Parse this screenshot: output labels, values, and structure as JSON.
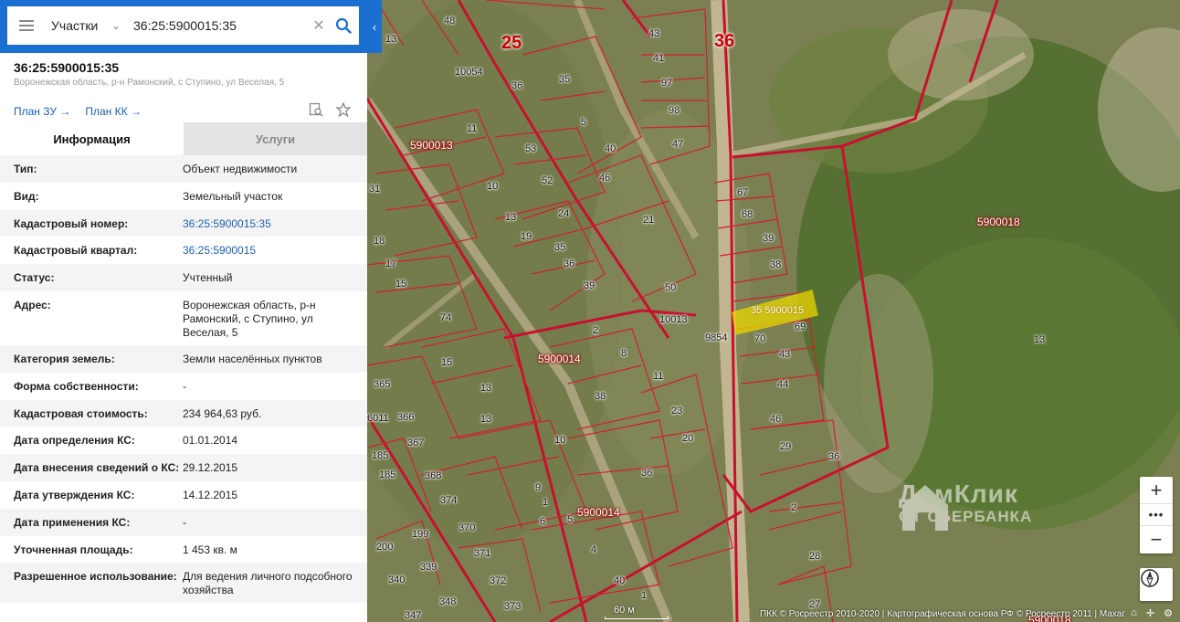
{
  "search": {
    "type_label": "Участки",
    "query": "36:25:5900015:35"
  },
  "object": {
    "title": "36:25:5900015:35",
    "address": "Воронежская область, р-н Рамонский, с Ступино, ул Веселая, 5",
    "plan_zu": "План ЗУ →",
    "plan_kk": "План КК →"
  },
  "tabs": [
    {
      "label": "Информация",
      "active": true
    },
    {
      "label": "Услуги",
      "active": false
    }
  ],
  "info": [
    {
      "key": "Тип:",
      "value": "Объект недвижимости"
    },
    {
      "key": "Вид:",
      "value": "Земельный участок"
    },
    {
      "key": "Кадастровый номер:",
      "value": "36:25:5900015:35",
      "link": true
    },
    {
      "key": "Кадастровый квартал:",
      "value": "36:25:5900015",
      "link": true
    },
    {
      "key": "Статус:",
      "value": "Учтенный"
    },
    {
      "key": "Адрес:",
      "value": "Воронежская область, р-н Рамонский, с Ступино, ул Веселая, 5"
    },
    {
      "key": "Категория земель:",
      "value": "Земли населённых пунктов"
    },
    {
      "key": "Форма собственности:",
      "value": "-"
    },
    {
      "key": "Кадастровая стоимость:",
      "value": "234 964,63 руб."
    },
    {
      "key": "Дата определения КС:",
      "value": "01.01.2014"
    },
    {
      "key": "Дата внесения сведений о КС:",
      "value": "29.12.2015"
    },
    {
      "key": "Дата утверждения КС:",
      "value": "14.12.2015"
    },
    {
      "key": "Дата применения КС:",
      "value": "-"
    },
    {
      "key": "Уточненная площадь:",
      "value": "1 453 кв. м"
    },
    {
      "key": "Разрешенное использование:",
      "value": "Для ведения личного подсобного хозяйства"
    }
  ],
  "map": {
    "district_labels": [
      "25",
      "36"
    ],
    "quarter_labels": [
      "5900013",
      "5900014",
      "5900014",
      "5900018",
      "5900015",
      "5900018"
    ],
    "parcel_labels": [
      "48",
      "13",
      "43",
      "41",
      "97",
      "98",
      "47",
      "35",
      "10054",
      "36",
      "11",
      "5",
      "53",
      "40",
      "46",
      "52",
      "10",
      "31",
      "13",
      "24",
      "21",
      "67",
      "68",
      "39",
      "38",
      "19",
      "35",
      "36",
      "39",
      "50",
      "18",
      "17",
      "15",
      "74",
      "10013",
      "69",
      "70",
      "43",
      "2",
      "8",
      "13",
      "11",
      "38",
      "44",
      "365",
      "366",
      "367",
      "15",
      "13",
      "10",
      "23",
      "20",
      "46",
      "29",
      "36",
      "185",
      "185",
      "368",
      "9",
      "1",
      "36",
      "374",
      "6",
      "5",
      "2",
      "199",
      "370",
      "4",
      "200",
      "339",
      "371",
      "340",
      "372",
      "348",
      "373",
      "347",
      "40",
      "1",
      "27",
      "28",
      "2",
      "36",
      "9854",
      "6011",
      "1",
      "13",
      "371"
    ],
    "selected_label": "35 5900015",
    "scale_label": "60 м",
    "copyright": "ПКК © Росреестр 2010-2020 | Картографическая основа РФ © Росреестр 2011 | Махаг",
    "watermark_title": "ДомКлик",
    "watermark_sub": "ОТ СБЕРБАНКА",
    "colors": {
      "boundary": "#c8102e",
      "selected": "#e8d800",
      "header": "#1a6fd0"
    }
  }
}
